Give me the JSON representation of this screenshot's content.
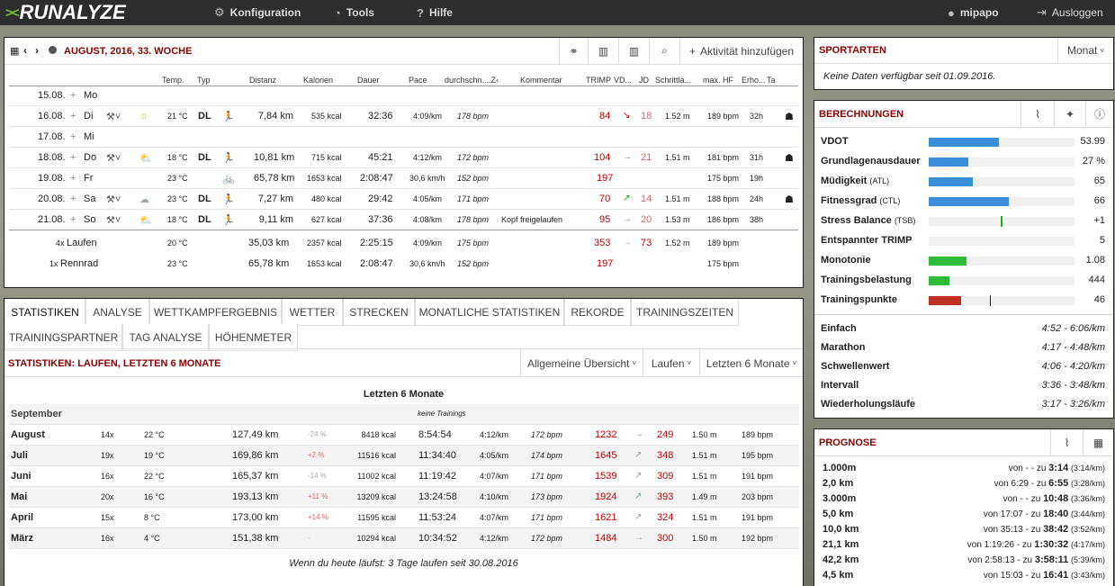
{
  "nav": {
    "logo": "RUNALYZE",
    "config": "Konfiguration",
    "tools": "Tools",
    "help": "Hilfe",
    "user": "mipapo",
    "logout": "Ausloggen"
  },
  "week": {
    "title": "AUGUST, 2016, 33. WOCHE",
    "add": "Aktivität hinzufügen",
    "headers": [
      "Temp.",
      "Typ",
      "Distanz",
      "Kalorien",
      "Dauer",
      "Pace",
      "durchschn....Z‹",
      "Kommentar",
      "TRIMP",
      "VD...",
      "JD",
      "Schrittlä...",
      "max. HF",
      "Erho...",
      "Ta"
    ],
    "days": [
      {
        "date": "15.08.",
        "day": "Mo"
      },
      {
        "date": "16.08.",
        "day": "Di",
        "temp": "21 °C",
        "type": "DL",
        "dist": "7,84 km",
        "kcal": "535 kcal",
        "dur": "32:36",
        "pace": "4:09/km",
        "hr": "178 bpm",
        "trimp": "84",
        "vd": "↘",
        "jd": "18",
        "step": "1.52 m",
        "maxhf": "189 bpm",
        "rec": "32h",
        "weather": "sun",
        "sport": "run"
      },
      {
        "date": "17.08.",
        "day": "Mi"
      },
      {
        "date": "18.08.",
        "day": "Do",
        "temp": "18 °C",
        "type": "DL",
        "dist": "10,81 km",
        "kcal": "715 kcal",
        "dur": "45:21",
        "pace": "4:12/km",
        "hr": "172 bpm",
        "trimp": "104",
        "vd": "→",
        "jd": "21",
        "step": "1.51 m",
        "maxhf": "181 bpm",
        "rec": "31h",
        "weather": "cloudsun",
        "sport": "run"
      },
      {
        "date": "19.08.",
        "day": "Fr",
        "temp": "23 °C",
        "type": "",
        "dist": "65,78 km",
        "kcal": "1653 kcal",
        "dur": "2:08:47",
        "pace": "30,6 km/h",
        "hr": "152 bpm",
        "trimp": "197",
        "vd": "",
        "jd": "",
        "step": "",
        "maxhf": "175 bpm",
        "rec": "19h",
        "weather": "sun",
        "sport": "bike"
      },
      {
        "date": "20.08.",
        "day": "Sa",
        "temp": "23 °C",
        "type": "DL",
        "dist": "7,27 km",
        "kcal": "480 kcal",
        "dur": "29:42",
        "pace": "4:05/km",
        "hr": "171 bpm",
        "trimp": "70",
        "vd": "↗",
        "jd": "14",
        "step": "1.51 m",
        "maxhf": "188 bpm",
        "rec": "24h",
        "weather": "cloud",
        "sport": "run"
      },
      {
        "date": "21.08.",
        "day": "So",
        "temp": "18 °C",
        "type": "DL",
        "dist": "9,11 km",
        "kcal": "627 kcal",
        "dur": "37:36",
        "pace": "4:08/km",
        "hr": "178 bpm",
        "comment": "Kopf freigelaufen",
        "trimp": "95",
        "vd": "→",
        "jd": "20",
        "step": "1.53 m",
        "maxhf": "186 bpm",
        "rec": "38h",
        "weather": "cloudsun",
        "sport": "run"
      }
    ],
    "totals": [
      {
        "count": "4x",
        "name": "Laufen",
        "temp": "20 °C",
        "dist": "35,03 km",
        "kcal": "2357 kcal",
        "dur": "2:25:15",
        "pace": "4:09/km",
        "hr": "175 bpm",
        "trimp": "353",
        "vd": "→",
        "jd": "73",
        "step": "1.52 m",
        "maxhf": "189 bpm"
      },
      {
        "count": "1x",
        "name": "Rennrad",
        "temp": "23 °C",
        "dist": "65,78 km",
        "kcal": "1653 kcal",
        "dur": "2:08:47",
        "pace": "30,6 km/h",
        "hr": "152 bpm",
        "trimp": "197",
        "maxhf": "175 bpm"
      }
    ]
  },
  "tabs": {
    "row1": [
      "STATISTIKEN",
      "ANALYSE",
      "WETTKAMPFERGEBNIS",
      "WETTER",
      "STRECKEN",
      "MONATLICHE STATISTIKEN",
      "REKORDE",
      "TRAININGSZEITEN"
    ],
    "row2": [
      "TRAININGSPARTNER",
      "TAG ANALYSE",
      "HÖHENMETER"
    ]
  },
  "stats": {
    "title": "STATISTIKEN: LAUFEN, LETZTEN 6 MONATE",
    "dd1": "Allgemeine Übersicht",
    "dd2": "Laufen",
    "dd3": "Letzten 6 Monate",
    "subtitle": "Letzten 6 Monate",
    "sep": {
      "month": "September",
      "note": "keine Trainings"
    },
    "rows": [
      {
        "month": "August",
        "n": "14x",
        "temp": "22 °C",
        "dist": "127,49 km",
        "pct": "-24 %",
        "kcal": "8418 kcal",
        "dur": "8:54:54",
        "pace": "4:12/km",
        "hr": "172 bpm",
        "trimp": "1232",
        "vd": "→",
        "jd": "249",
        "step": "1.50 m",
        "maxhf": "189 bpm"
      },
      {
        "month": "Juli",
        "n": "19x",
        "temp": "19 °C",
        "dist": "169,86 km",
        "pct": "+2 %",
        "kcal": "11516 kcal",
        "dur": "11:34:40",
        "pace": "4:05/km",
        "hr": "174 bpm",
        "trimp": "1645",
        "vd": "↗",
        "jd": "348",
        "step": "1.51 m",
        "maxhf": "195 bpm"
      },
      {
        "month": "Juni",
        "n": "16x",
        "temp": "22 °C",
        "dist": "165,37 km",
        "pct": "-14 %",
        "kcal": "11002 kcal",
        "dur": "11:19:42",
        "pace": "4:07/km",
        "hr": "171 bpm",
        "trimp": "1539",
        "vd": "↗",
        "jd": "309",
        "step": "1.51 m",
        "maxhf": "191 bpm"
      },
      {
        "month": "Mai",
        "n": "20x",
        "temp": "16 °C",
        "dist": "193,13 km",
        "pct": "+11 %",
        "kcal": "13209 kcal",
        "dur": "13:24:58",
        "pace": "4:10/km",
        "hr": "173 bpm",
        "trimp": "1924",
        "vd": "↗",
        "jd": "393",
        "step": "1.49 m",
        "maxhf": "203 bpm"
      },
      {
        "month": "April",
        "n": "15x",
        "temp": "8 °C",
        "dist": "173,00 km",
        "pct": "+14 %",
        "kcal": "11595 kcal",
        "dur": "11:53:24",
        "pace": "4:07/km",
        "hr": "171 bpm",
        "trimp": "1621",
        "vd": "↗",
        "jd": "324",
        "step": "1.51 m",
        "maxhf": "191 bpm"
      },
      {
        "month": "März",
        "n": "16x",
        "temp": "4 °C",
        "dist": "151,38 km",
        "pct": "-",
        "kcal": "10294 kcal",
        "dur": "10:34:52",
        "pace": "4:12/km",
        "hr": "172 bpm",
        "trimp": "1484",
        "vd": "→",
        "jd": "300",
        "step": "1.50 m",
        "maxhf": "192 bpm"
      }
    ],
    "footer": "Wenn du heute läufst: 3 Tage laufen seit 30.08.2016"
  },
  "sports": {
    "title": "SPORTARTEN",
    "dropdown": "Monat",
    "empty": "Keine Daten verfügbar seit 01.09.2016."
  },
  "calc": {
    "title": "BERECHNUNGEN",
    "rows": [
      {
        "label": "VDOT",
        "value": "53.99",
        "fill": 0.48,
        "color": "#3a8fd8"
      },
      {
        "label": "Grundlagenausdauer",
        "value": "27 %",
        "fill": 0.27,
        "color": "#3a8fd8"
      },
      {
        "label": "Müdigkeit",
        "sub": "(ATL)",
        "value": "65",
        "fill": 0.3,
        "color": "#3a8fd8"
      },
      {
        "label": "Fitnessgrad",
        "sub": "(CTL)",
        "value": "66",
        "fill": 0.55,
        "color": "#3a8fd8"
      },
      {
        "label": "Stress Balance",
        "sub": "(TSB)",
        "value": "+1",
        "fill": 0,
        "color": "#2a2"
      },
      {
        "label": "Entspannter TRIMP",
        "value": "5",
        "fill": 0,
        "color": "#3a8fd8"
      },
      {
        "label": "Monotonie",
        "value": "1.08",
        "fill": 0.26,
        "color": "#2dbb3a"
      },
      {
        "label": "Trainingsbelastung",
        "value": "444",
        "fill": 0.14,
        "color": "#2dbb3a"
      },
      {
        "label": "Trainingspunkte",
        "value": "46",
        "fill": 0.22,
        "color": "#c03020"
      }
    ],
    "paces": [
      {
        "label": "Einfach",
        "value": "4:52 - 6:06/km"
      },
      {
        "label": "Marathon",
        "value": "4:17 - 4:48/km"
      },
      {
        "label": "Schwellenwert",
        "value": "4:06 - 4:20/km"
      },
      {
        "label": "Intervall",
        "value": "3:36 - 3:48/km"
      },
      {
        "label": "Wiederholungsläufe",
        "value": "3:17 - 3:26/km"
      }
    ]
  },
  "prog": {
    "title": "PROGNOSE",
    "rows": [
      {
        "label": "1.000m",
        "from": "-",
        "to": "3:14",
        "pace": "(3:14/km)"
      },
      {
        "label": "2,0 km",
        "from": "6:29",
        "to": "6:55",
        "pace": "(3:28/km)"
      },
      {
        "label": "3.000m",
        "from": "-",
        "to": "10:48",
        "pace": "(3:36/km)"
      },
      {
        "label": "5,0 km",
        "from": "17:07",
        "to": "18:40",
        "pace": "(3:44/km)"
      },
      {
        "label": "10,0 km",
        "from": "35:13",
        "to": "38:42",
        "pace": "(3:52/km)"
      },
      {
        "label": "21,1 km",
        "from": "1:19:26",
        "to": "1:30:32",
        "pace": "(4:17/km)"
      },
      {
        "label": "42,2 km",
        "from": "2:58:13",
        "to": "3:58:11",
        "pace": "(5:39/km)"
      },
      {
        "label": "4,5 km",
        "from": "15:03",
        "to": "16:41",
        "pace": "(3:43/km)"
      }
    ]
  }
}
